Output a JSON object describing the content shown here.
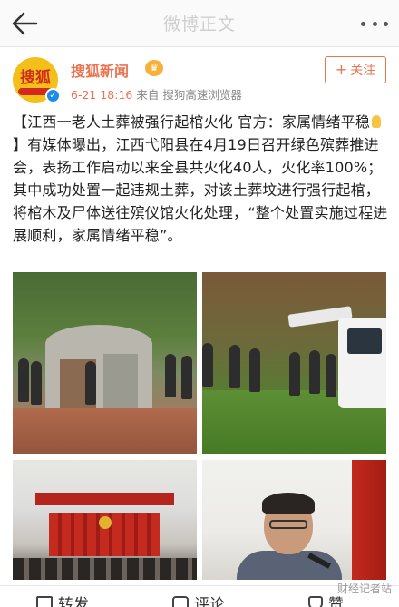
{
  "header": {
    "title": "微博正文"
  },
  "author": {
    "avatar_text": "搜狐",
    "name": "搜狐新闻",
    "time": "6-21 18:16",
    "source": "来自 搜狗高速浏览器",
    "follow_label": "关注"
  },
  "post": {
    "part1": "【江西一老人土葬被强行起棺火化 官方：家属情绪平稳",
    "part2": "】有媒体曝出，江西弋阳县在4月19日召开绿色殡葬推进会，表扬工作启动以来全县共火化40人，火化率100%；其中成功处置一起违规土葬，对该土葬坟进行强行起棺，将棺木及尸体送往殡仪馆火化处理，“整个处置实施过程进展顺利，家属情绪平稳”。"
  },
  "watermark": "财经记者站",
  "actions": {
    "repost": "转发",
    "comment": "评论",
    "like": "赞"
  },
  "colors": {
    "accent": "#eb7350",
    "verified": "#1b8de6"
  }
}
